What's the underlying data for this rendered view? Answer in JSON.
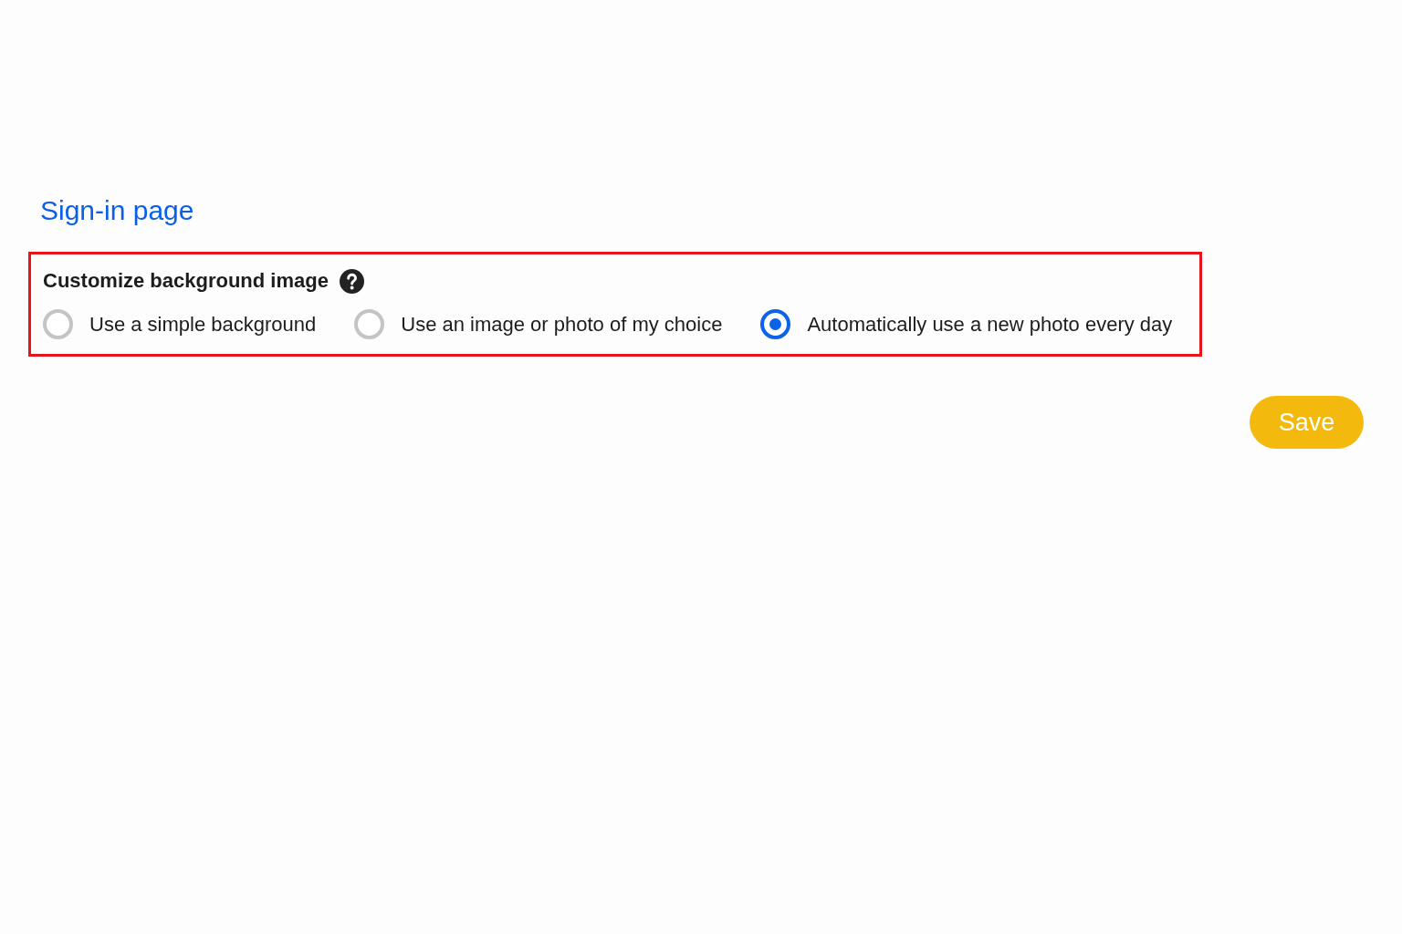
{
  "section_heading": "Sign-in page",
  "setting": {
    "title": "Customize background image",
    "highlighted": true,
    "options": [
      {
        "label": "Use a simple background",
        "selected": false
      },
      {
        "label": "Use an image or photo of my choice",
        "selected": false
      },
      {
        "label": "Automatically use a new photo every day",
        "selected": true
      }
    ]
  },
  "save_button": "Save"
}
